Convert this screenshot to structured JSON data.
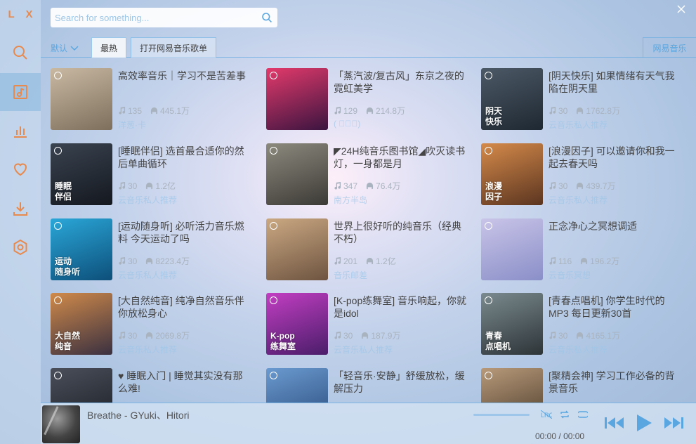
{
  "app": {
    "logo": "L X"
  },
  "search": {
    "placeholder": "Search for something..."
  },
  "tabs": {
    "sort_label": "默认",
    "items": [
      {
        "label": "最热"
      },
      {
        "label": "打开网易音乐歌单"
      }
    ],
    "source_label": "网易音乐"
  },
  "playlists": [
    {
      "title": "高效率音乐｜学习不是苦差事",
      "plays": "135",
      "listens": "445.1万",
      "author": "洋葱·卡",
      "cover_text": "",
      "colors": [
        "#c9b9a3",
        "#7d6f5c"
      ]
    },
    {
      "title": "「蒸汽波/复古风」东京之夜的霓虹美学",
      "plays": "129",
      "listens": "214.8万",
      "author": "( ﾟ∀ﾟ)",
      "cover_text": "",
      "colors": [
        "#e23a6b",
        "#3b1440"
      ]
    },
    {
      "title": "[阴天快乐] 如果情绪有天气我陷在阴天里",
      "plays": "30",
      "listens": "1762.8万",
      "author": "云音乐私人推荐",
      "cover_text": "阴天\n快乐",
      "colors": [
        "#4c5966",
        "#1e2832"
      ]
    },
    {
      "title": "[睡眠伴侣] 选首最合适你的然后单曲循环",
      "plays": "30",
      "listens": "1.2亿",
      "author": "云音乐私人推荐",
      "cover_text": "睡眠\n伴侣",
      "colors": [
        "#3a4350",
        "#14181f"
      ]
    },
    {
      "title": "◤24H纯音乐图书馆◢吹灭读书灯，一身都是月",
      "plays": "347",
      "listens": "76.4万",
      "author": "南方半岛",
      "cover_text": "",
      "colors": [
        "#8c8a7e",
        "#3c3a35"
      ]
    },
    {
      "title": "[浪漫因子] 可以邀请你和我一起去春天吗",
      "plays": "30",
      "listens": "439.7万",
      "author": "云音乐私人推荐",
      "cover_text": "浪漫\n因子",
      "colors": [
        "#d58a4a",
        "#5b3520"
      ]
    },
    {
      "title": "[运动随身听] 必听活力音乐燃料 今天运动了吗",
      "plays": "30",
      "listens": "8223.4万",
      "author": "云音乐私人推荐",
      "cover_text": "运动\n随身听",
      "colors": [
        "#2aa7d8",
        "#0d4f7a"
      ]
    },
    {
      "title": "世界上很好听的纯音乐（经典不朽）",
      "plays": "201",
      "listens": "1.2亿",
      "author": "音乐邮差",
      "cover_text": "",
      "colors": [
        "#caa882",
        "#6e5440"
      ]
    },
    {
      "title": "正念净心之冥想调适",
      "plays": "116",
      "listens": "196.2万",
      "author": "云音乐冥想",
      "cover_text": "",
      "colors": [
        "#c9c4e8",
        "#8a8fc8"
      ]
    },
    {
      "title": "[大自然纯音] 纯净自然音乐伴你放松身心",
      "plays": "30",
      "listens": "2069.8万",
      "author": "云音乐私人推荐",
      "cover_text": "大自然\n纯音",
      "colors": [
        "#d08a4a",
        "#3a3040"
      ]
    },
    {
      "title": "[K-pop练舞室] 音乐响起，你就是idol",
      "plays": "30",
      "listens": "187.9万",
      "author": "云音乐私人推荐",
      "cover_text": "K-pop\n练舞室",
      "colors": [
        "#c23ec2",
        "#4a1d6a"
      ]
    },
    {
      "title": "[青春点唱机] 你学生时代的MP3 每日更新30首",
      "plays": "30",
      "listens": "4165.1万",
      "author": "云音乐私人推荐",
      "cover_text": "青春\n点唱机",
      "colors": [
        "#7a8a8e",
        "#2d3438"
      ]
    },
    {
      "title": "♥ 睡眠入门 | 睡觉其实没有那么难!",
      "plays": "",
      "listens": "",
      "author": "",
      "cover_text": "",
      "colors": [
        "#4a4f5a",
        "#1a1d24"
      ]
    },
    {
      "title": "「轻音乐·安静」舒缓放松，缓解压力",
      "plays": "",
      "listens": "",
      "author": "",
      "cover_text": "",
      "colors": [
        "#6a9ad0",
        "#2a4a7a"
      ]
    },
    {
      "title": "[聚精会神] 学习工作必备的背景音乐",
      "plays": "",
      "listens": "",
      "author": "",
      "cover_text": "",
      "colors": [
        "#b89a7a",
        "#4a3a2a"
      ]
    }
  ],
  "player": {
    "title": "Breathe - GYuki、Hitori",
    "time_current": "00:00",
    "time_total": "00:00",
    "time_separator": "/",
    "progress": 0
  },
  "colors": {
    "accent": "#5aa6e0",
    "logo": "#e58a52"
  }
}
